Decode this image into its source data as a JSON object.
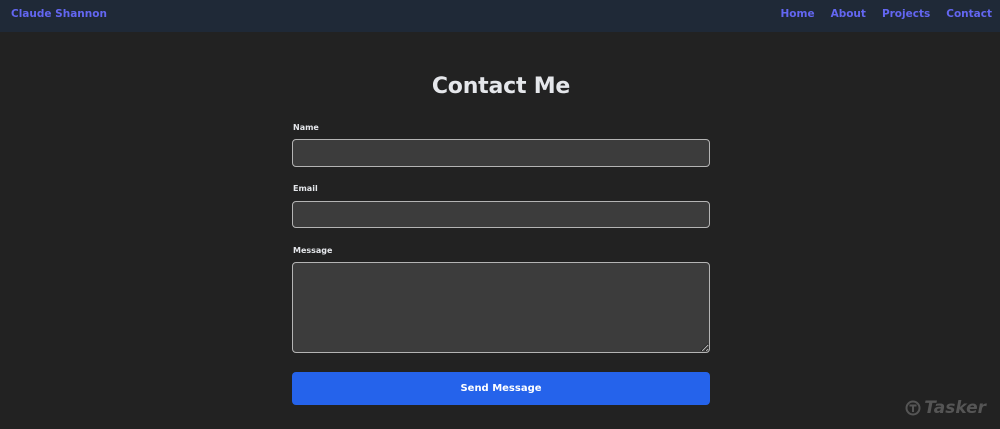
{
  "navbar": {
    "brand": "Claude Shannon",
    "links": [
      {
        "label": "Home"
      },
      {
        "label": "About"
      },
      {
        "label": "Projects"
      },
      {
        "label": "Contact"
      }
    ]
  },
  "page": {
    "title": "Contact Me"
  },
  "form": {
    "name": {
      "label": "Name",
      "value": ""
    },
    "email": {
      "label": "Email",
      "value": ""
    },
    "message": {
      "label": "Message",
      "value": ""
    },
    "submit_label": "Send Message"
  },
  "watermark": {
    "text": "Tasker"
  },
  "colors": {
    "background": "#222222",
    "navbar": "#1f2937",
    "accent_link": "#6366f1",
    "button": "#2563eb",
    "field_background": "#3c3c3c",
    "field_border": "#b4b4b4"
  }
}
